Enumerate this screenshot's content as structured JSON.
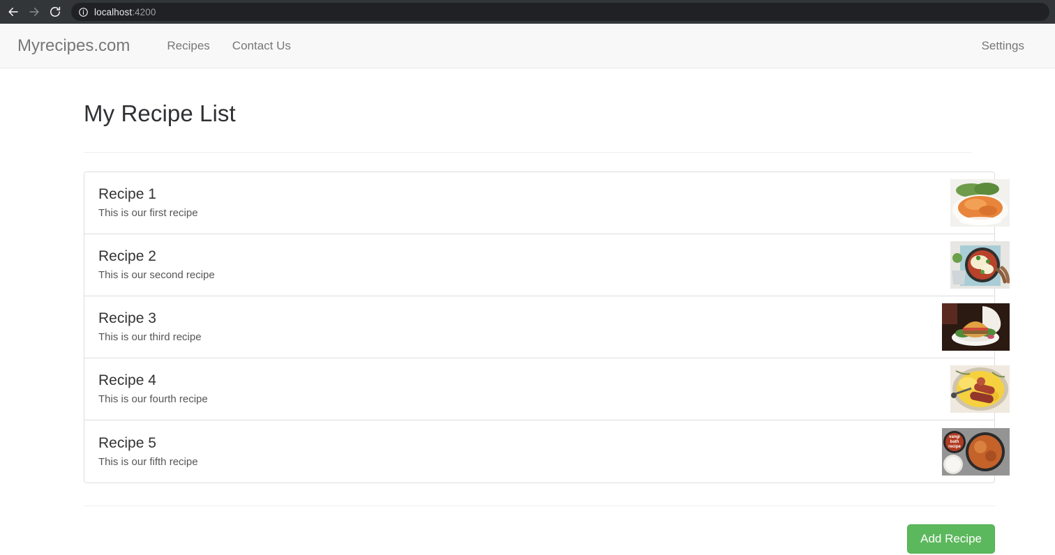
{
  "browser": {
    "back_icon": "arrow-left-icon",
    "forward_icon": "arrow-right-icon",
    "reload_icon": "reload-icon",
    "info_icon": "info-circle-icon",
    "url_host": "localhost",
    "url_port": ":4200",
    "url_full": "localhost:4200"
  },
  "navbar": {
    "brand": "Myrecipes.com",
    "links": [
      {
        "label": "Recipes"
      },
      {
        "label": "Contact Us"
      }
    ],
    "right_links": [
      {
        "label": "Settings"
      }
    ]
  },
  "main": {
    "title": "My Recipe List",
    "recipes": [
      {
        "title": "Recipe 1",
        "description": "This is our first recipe",
        "image_alt": "orange-pasta-on-white-plate-thumbnail"
      },
      {
        "title": "Recipe 2",
        "description": "This is our second recipe",
        "image_alt": "skillet-pasta-bake-thumbnail"
      },
      {
        "title": "Recipe 3",
        "description": "This is our third recipe",
        "image_alt": "burger-on-white-plate-thumbnail"
      },
      {
        "title": "Recipe 4",
        "description": "This is our fourth recipe",
        "image_alt": "scrambled-eggs-with-sausage-thumbnail"
      },
      {
        "title": "Recipe 5",
        "description": "This is our fifth recipe",
        "image_alt": "vangi-bath-recipe-bowls-thumbnail",
        "image_caption": "vangi bath recipe"
      }
    ],
    "add_button": "Add Recipe"
  },
  "colors": {
    "accent_green": "#5cb85c",
    "navbar_bg": "#f8f8f8",
    "border": "#dddddd",
    "chrome_bg": "#323639",
    "omnibox_bg": "#202124"
  }
}
